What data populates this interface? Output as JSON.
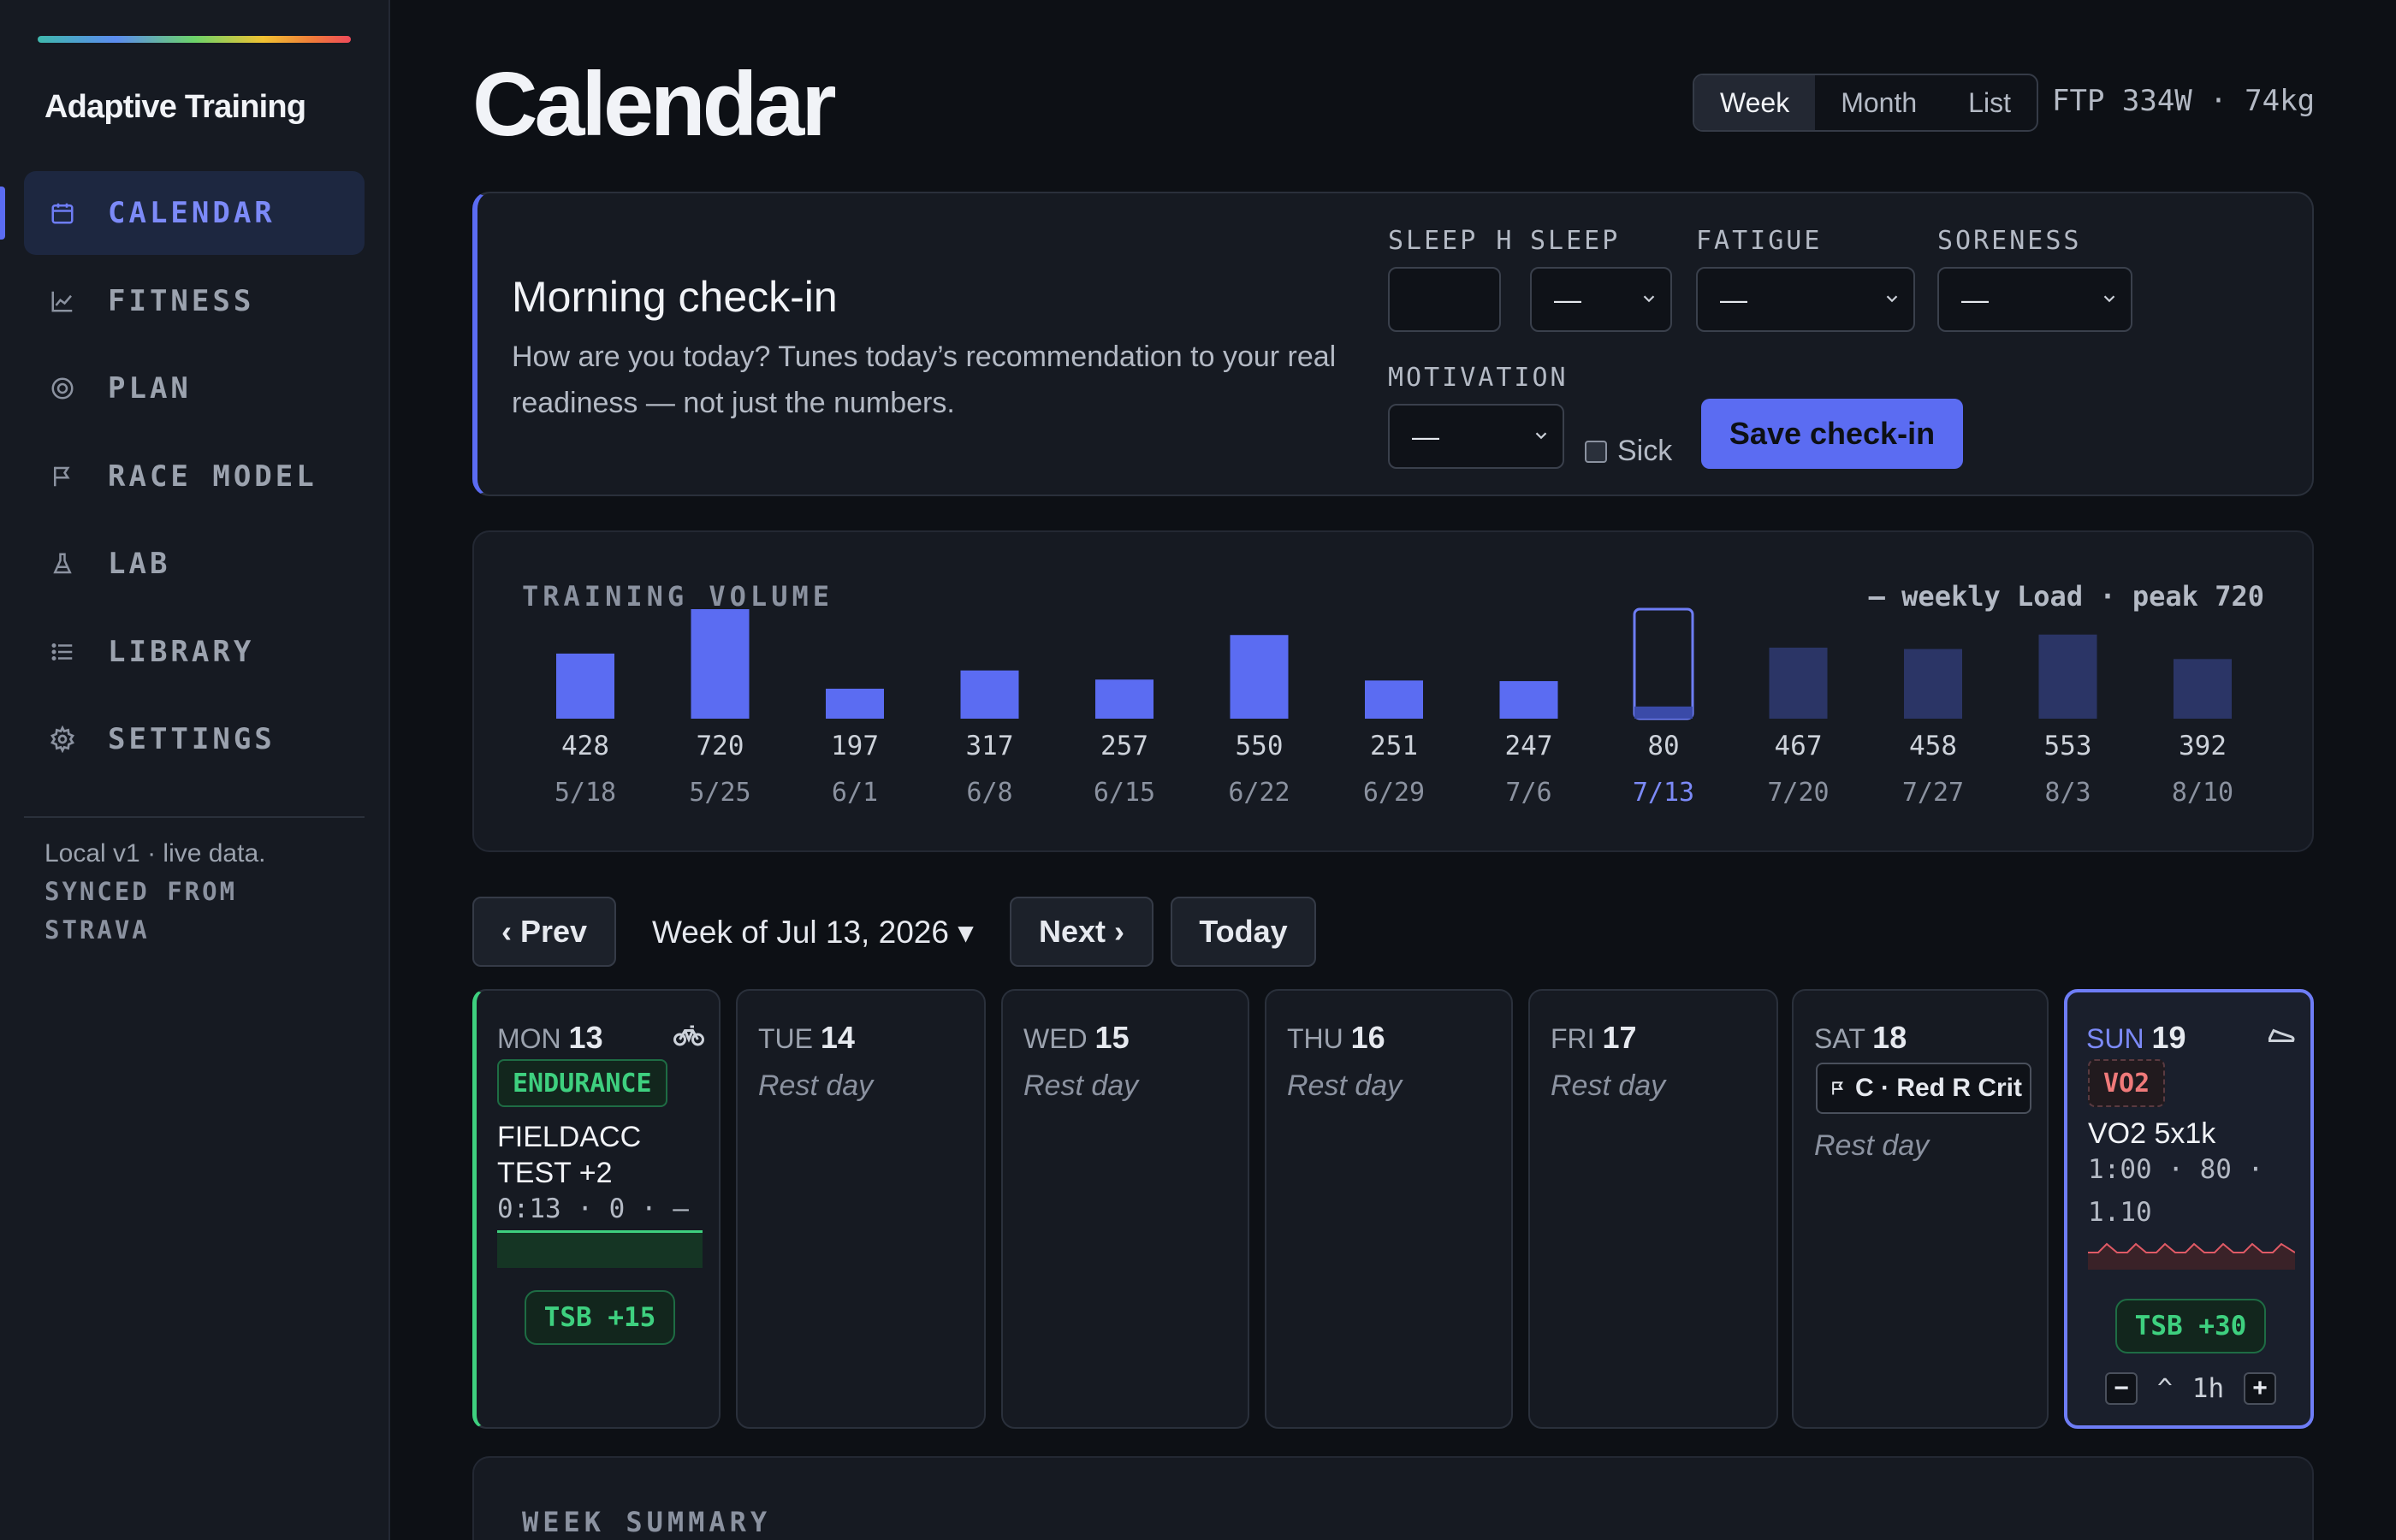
{
  "app": {
    "brand": "Adaptive Training"
  },
  "sidebar": {
    "items": [
      {
        "label": "CALENDAR",
        "icon": "calendar-icon",
        "active": true
      },
      {
        "label": "FITNESS",
        "icon": "chart-line-icon",
        "active": false
      },
      {
        "label": "PLAN",
        "icon": "target-icon",
        "active": false
      },
      {
        "label": "RACE MODEL",
        "icon": "flag-icon",
        "active": false
      },
      {
        "label": "LAB",
        "icon": "flask-icon",
        "active": false
      },
      {
        "label": "LIBRARY",
        "icon": "list-icon",
        "active": false
      },
      {
        "label": "SETTINGS",
        "icon": "gear-icon",
        "active": false
      }
    ],
    "note": "Local v1 · live data.",
    "sync": "SYNCED FROM STRAVA"
  },
  "header": {
    "title": "Calendar",
    "views": [
      "Week",
      "Month",
      "List"
    ],
    "active_view": "Week",
    "athlete": "FTP 334W · 74kg"
  },
  "checkin": {
    "title": "Morning check-in",
    "description": "How are you today? Tunes today’s recommendation to your real readiness — not just the numbers.",
    "sleep_h_label": "SLEEP H",
    "sleep_h_value": "",
    "sleep_label": "SLEEP",
    "sleep_value": "—",
    "fatigue_label": "FATIGUE",
    "fatigue_value": "—",
    "soreness_label": "SORENESS",
    "soreness_value": "—",
    "motivation_label": "MOTIVATION",
    "motivation_value": "—",
    "sick_label": "Sick",
    "sick_checked": false,
    "save_label": "Save check-in"
  },
  "volume": {
    "title": "TRAINING VOLUME",
    "legend": "— weekly Load · peak 720",
    "colors": {
      "past": "#5b6cf2",
      "future": "#2b3566",
      "current_outline": "#6e7df6"
    }
  },
  "chart_data": {
    "type": "bar",
    "categories": [
      "5/18",
      "5/25",
      "6/1",
      "6/8",
      "6/15",
      "6/22",
      "6/29",
      "7/6",
      "7/13",
      "7/20",
      "7/27",
      "8/3",
      "8/10"
    ],
    "values": [
      428,
      720,
      197,
      317,
      257,
      550,
      251,
      247,
      80,
      467,
      458,
      553,
      392
    ],
    "current_index": 8,
    "legend": "— weekly Load · peak 720",
    "ylim": [
      0,
      720
    ]
  },
  "week_nav": {
    "prev_label": "‹ Prev",
    "week_label": "Week of Jul 13, 2026 ▾",
    "next_label": "Next ›",
    "today_label": "Today"
  },
  "days": [
    {
      "dow": "MON",
      "date": "13",
      "icon": "bike-icon",
      "tag": "ENDURANCE",
      "workout": "FIELDACC TEST +2",
      "meta": "0:13 · 0 · —",
      "tsb": "TSB +15"
    },
    {
      "dow": "TUE",
      "date": "14",
      "rest": "Rest day"
    },
    {
      "dow": "WED",
      "date": "15",
      "rest": "Rest day"
    },
    {
      "dow": "THU",
      "date": "16",
      "rest": "Rest day"
    },
    {
      "dow": "FRI",
      "date": "17",
      "rest": "Rest day"
    },
    {
      "dow": "SAT",
      "date": "18",
      "race": "C · Red R Crit",
      "rest": "Rest day"
    },
    {
      "dow": "SUN",
      "date": "19",
      "icon": "shoe-icon",
      "tag": "VO2",
      "workout": "VO2 5x1k",
      "meta": "1:00 · 80 · 1.10",
      "tsb": "TSB +30",
      "minus": "−",
      "caret": "^",
      "duration": "1h",
      "plus": "+"
    }
  ],
  "summary": {
    "title": "WEEK SUMMARY"
  }
}
